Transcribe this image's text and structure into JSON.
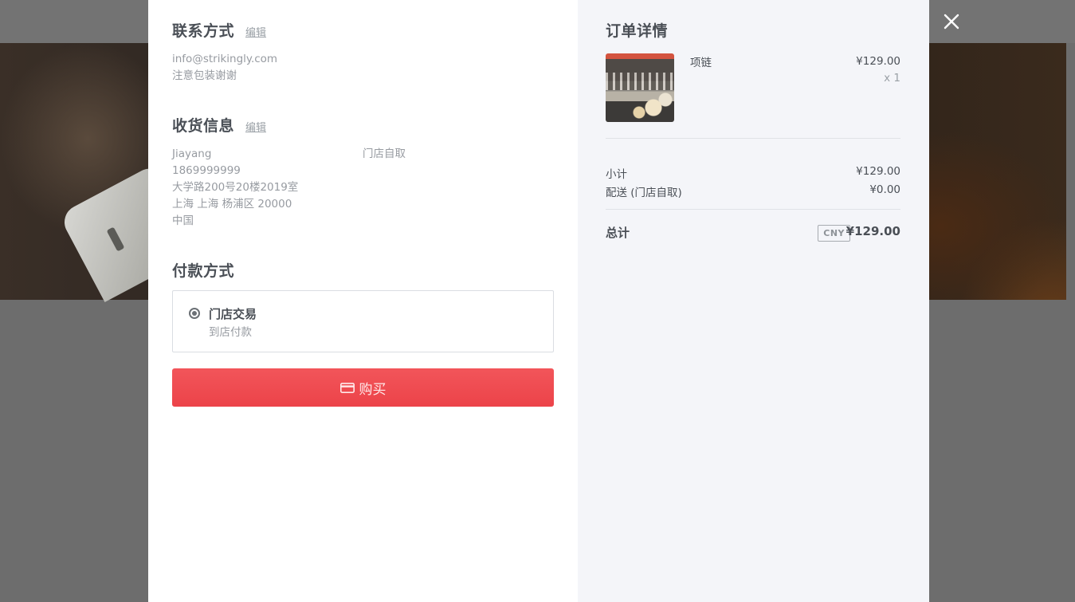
{
  "contact": {
    "title": "联系方式",
    "edit_label": "编辑",
    "email": "info@strikingly.com",
    "note": "注意包装谢谢"
  },
  "shipping": {
    "title": "收货信息",
    "edit_label": "编辑",
    "name": "Jiayang",
    "phone": "1869999999",
    "address_line": "大学路200号20楼2019室",
    "city_line": "上海 上海 杨浦区 20000",
    "country": "中国",
    "method": "门店自取"
  },
  "payment": {
    "title": "付款方式",
    "option_title": "门店交易",
    "option_desc": "到店付款",
    "selected": true
  },
  "buy_button": {
    "label": "购买",
    "icon": "credit-card-icon",
    "color": "#ef4a4f"
  },
  "order": {
    "title": "订单详情",
    "item": {
      "name": "项链",
      "price": "¥129.00",
      "quantity": "x 1",
      "image": "necklace-thumbnail"
    },
    "subtotal_label": "小计",
    "subtotal_value": "¥129.00",
    "shipping_label": "配送 (门店自取)",
    "shipping_value": "¥0.00",
    "total_label": "总计",
    "currency": "CNY",
    "total_value": "¥129.00"
  },
  "close_icon": "close-icon"
}
